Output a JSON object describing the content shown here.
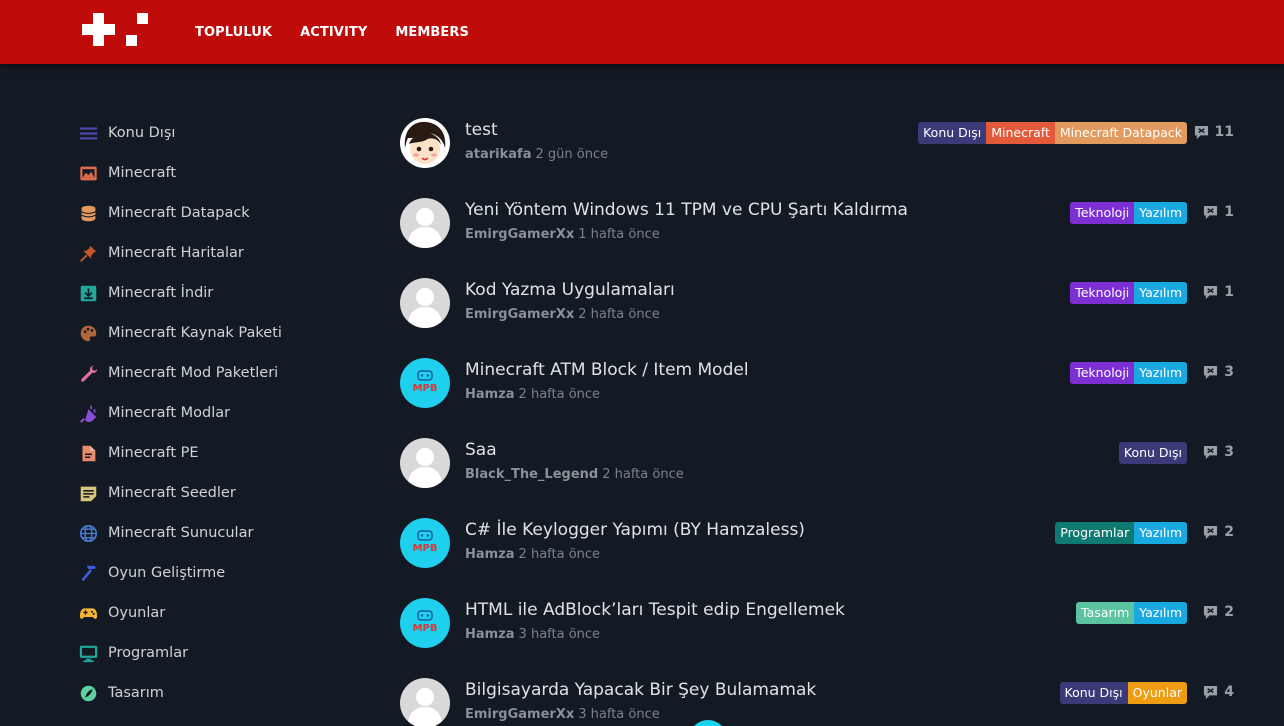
{
  "header": {
    "nav": [
      "TOPLULUK",
      "ACTIVITY",
      "MEMBERS"
    ],
    "color": "#c00b0b"
  },
  "sidebar": {
    "items": [
      {
        "label": "Konu Dışı",
        "icon": "menu-lines-icon",
        "color": "#4e46a8"
      },
      {
        "label": "Minecraft",
        "icon": "image-frame-icon",
        "color": "#e06a4c"
      },
      {
        "label": "Minecraft Datapack",
        "icon": "database-icon",
        "color": "#e39a5e"
      },
      {
        "label": "Minecraft Haritalar",
        "icon": "pushpin-icon",
        "color": "#c5562b"
      },
      {
        "label": "Minecraft İndir",
        "icon": "download-icon",
        "color": "#23a79d"
      },
      {
        "label": "Minecraft Kaynak Paketi",
        "icon": "palette-icon",
        "color": "#b4663a"
      },
      {
        "label": "Minecraft Mod Paketleri",
        "icon": "wrench-icon",
        "color": "#e0709e"
      },
      {
        "label": "Minecraft Modlar",
        "icon": "plug-icon",
        "color": "#8b4fd6"
      },
      {
        "label": "Minecraft PE",
        "icon": "file-icon",
        "color": "#e88b6b"
      },
      {
        "label": "Minecraft Seedler",
        "icon": "note-icon",
        "color": "#d6c57a"
      },
      {
        "label": "Minecraft Sunucular",
        "icon": "globe-icon",
        "color": "#4a7fd6"
      },
      {
        "label": "Oyun Geliştirme",
        "icon": "hammer-icon",
        "color": "#3f5de0"
      },
      {
        "label": "Oyunlar",
        "icon": "gamepad-icon",
        "color": "#f2b533"
      },
      {
        "label": "Programlar",
        "icon": "monitor-icon",
        "color": "#1fa89a"
      },
      {
        "label": "Tasarım",
        "icon": "leaf-icon",
        "color": "#5fd1a0"
      }
    ]
  },
  "tag_colors": {
    "Konu Dışı": "#3b3a78",
    "Minecraft": "#e25a3a",
    "Minecraft Datapack": "#e39a5e",
    "Teknoloji": "#7c2fd3",
    "Yazılım": "#19a8e0",
    "Programlar": "#0f7a72",
    "Tasarım": "#5cc3a0",
    "Oyunlar": "#ee9c12"
  },
  "topics": [
    {
      "title": "test",
      "user": "atarikafa",
      "time": "2 gün önce",
      "avatar": "cartoon",
      "tags": [
        "Konu Dışı",
        "Minecraft",
        "Minecraft Datapack"
      ],
      "replies": "11"
    },
    {
      "title": "Yeni Yöntem Windows 11 TPM ve CPU Şartı Kaldırma",
      "user": "EmirgGamerXx",
      "time": "1 hafta önce",
      "avatar": "default",
      "tags": [
        "Teknoloji",
        "Yazılım"
      ],
      "replies": "1"
    },
    {
      "title": "Kod Yazma Uygulamaları",
      "user": "EmirgGamerXx",
      "time": "2 hafta önce",
      "avatar": "default",
      "tags": [
        "Teknoloji",
        "Yazılım"
      ],
      "replies": "1"
    },
    {
      "title": "Minecraft ATM Block / Item Model",
      "user": "Hamza",
      "time": "2 hafta önce",
      "avatar": "mpb",
      "tags": [
        "Teknoloji",
        "Yazılım"
      ],
      "replies": "3"
    },
    {
      "title": "Saa",
      "user": "Black_The_Legend",
      "time": "2 hafta önce",
      "avatar": "default",
      "tags": [
        "Konu Dışı"
      ],
      "replies": "3"
    },
    {
      "title": "C# İle Keylogger Yapımı (BY Hamzaless)",
      "user": "Hamza",
      "time": "2 hafta önce",
      "avatar": "mpb",
      "tags": [
        "Programlar",
        "Yazılım"
      ],
      "replies": "2"
    },
    {
      "title": "HTML ile AdBlock’ları Tespit edip Engellemek",
      "user": "Hamza",
      "time": "3 hafta önce",
      "avatar": "mpb",
      "tags": [
        "Tasarım",
        "Yazılım"
      ],
      "replies": "2"
    },
    {
      "title": "Bilgisayarda Yapacak Bir Şey Bulamamak",
      "user": "EmirgGamerXx",
      "time": "3 hafta önce",
      "avatar": "default",
      "tags": [
        "Konu Dışı",
        "Oyunlar"
      ],
      "replies": "4"
    }
  ],
  "avatar_mpb_text": "MPB"
}
